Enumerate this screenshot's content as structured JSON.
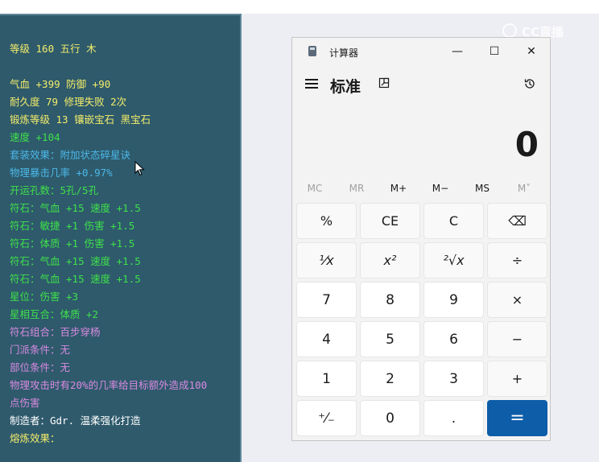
{
  "tooltip": {
    "lines": [
      {
        "text": "等级 160 五行 木",
        "color": "#f3ec6a"
      },
      {
        "text": "气血 +399 防御 +90",
        "color": "#f3ec6a"
      },
      {
        "text": "耐久度 79 修理失败 2次",
        "color": "#f3ec6a"
      },
      {
        "text": "锻炼等级 13 镶嵌宝石 黑宝石",
        "color": "#f3ec6a"
      },
      {
        "text": "速度 +104",
        "color": "#3fe04a"
      },
      {
        "text": "套装效果：附加状态碎星诀",
        "color": "#4cb8e8"
      },
      {
        "text": "物理暴击几率 +0.97%",
        "color": "#4cb8e8"
      },
      {
        "text": "开运孔数：5孔/5孔",
        "color": "#3fe04a"
      },
      {
        "text": "符石：气血 +15 速度 +1.5",
        "color": "#3fe04a"
      },
      {
        "text": "符石：敏捷 +1 伤害 +1.5",
        "color": "#3fe04a"
      },
      {
        "text": "符石：体质 +1 伤害 +1.5",
        "color": "#3fe04a"
      },
      {
        "text": "符石：气血 +15 速度 +1.5",
        "color": "#3fe04a"
      },
      {
        "text": "符石：气血 +15 速度 +1.5",
        "color": "#3fe04a"
      },
      {
        "text": "星位：伤害 +3",
        "color": "#3fe04a"
      },
      {
        "text": "星相互合：体质 +2",
        "color": "#3fe04a"
      },
      {
        "text": "符石组合：百步穿杨",
        "color": "#d98ae0"
      },
      {
        "text": "门派条件：无",
        "color": "#d98ae0"
      },
      {
        "text": "部位条件：无",
        "color": "#d98ae0"
      },
      {
        "text": "物理攻击时有20%的几率给目标额外造成100",
        "color": "#d98ae0"
      },
      {
        "text": "点伤害",
        "color": "#d98ae0"
      },
      {
        "text": "制造者：Gdr. 温柔强化打造",
        "color": "#ffffff"
      },
      {
        "text": "熔炼效果：",
        "color": "#f3ec6a"
      }
    ]
  },
  "watermark": {
    "text": "CC直播"
  },
  "calculator": {
    "app_title": "计算器",
    "mode_title": "标准",
    "window_buttons": {
      "minimize": "—",
      "maximize": "☐",
      "close": "✕"
    },
    "display_value": "0",
    "memory_buttons": [
      "MC",
      "MR",
      "M+",
      "M−",
      "MS",
      "M˅"
    ],
    "keys": [
      [
        "%",
        "CE",
        "C",
        "⌫"
      ],
      [
        "¹⁄x",
        "x²",
        "²√x",
        "÷"
      ],
      [
        "7",
        "8",
        "9",
        "×"
      ],
      [
        "4",
        "5",
        "6",
        "−"
      ],
      [
        "1",
        "2",
        "3",
        "+"
      ],
      [
        "⁺⁄₋",
        "0",
        ".",
        "="
      ]
    ],
    "colors": {
      "accent": "#0e5da8",
      "window_bg": "#f3f3f3"
    }
  }
}
